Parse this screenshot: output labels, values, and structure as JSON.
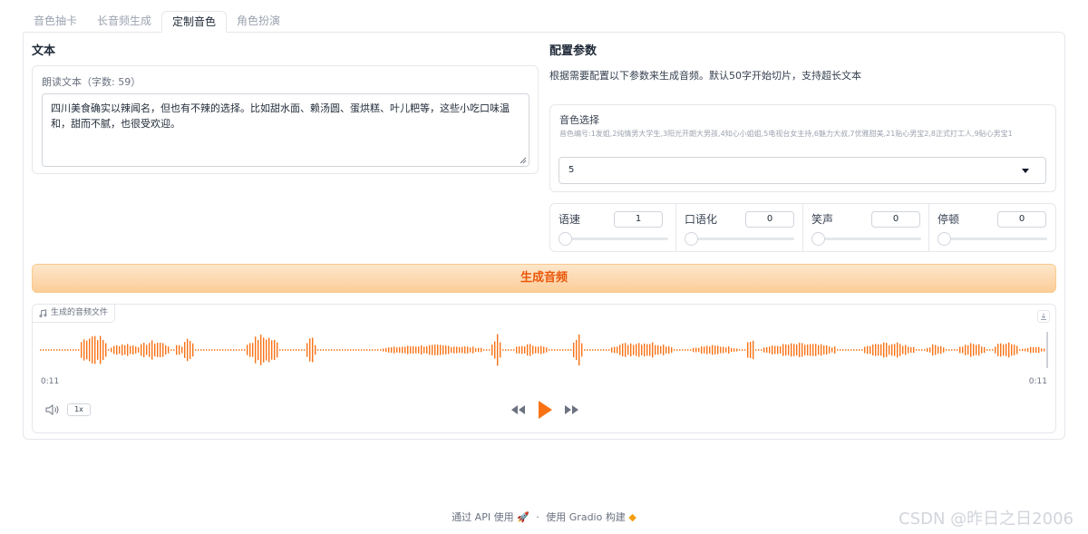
{
  "tabs": [
    {
      "label": "音色抽卡",
      "active": false
    },
    {
      "label": "长音频生成",
      "active": false
    },
    {
      "label": "定制音色",
      "active": true
    },
    {
      "label": "角色扮演",
      "active": false
    }
  ],
  "text_section": {
    "title": "文本",
    "field_label": "朗读文本（字数: 59）",
    "value": "四川美食确实以辣闻名，但也有不辣的选择。比如甜水面、赖汤圆、蛋烘糕、叶儿粑等，这些小吃口味温和，甜而不腻，也很受欢迎。"
  },
  "config_section": {
    "title": "配置参数",
    "description": "根据需要配置以下参数来生成音频。默认50字开始切片，支持超长文本",
    "voice": {
      "label": "音色选择",
      "hint": "音色编号:1发姐,2纯情男大学生,3阳光开朗大男孩,4知心小姐姐,5电视台女主持,6魅力大叔,7优雅甜美,21贴心男宝2,8正式打工人,9贴心男宝1",
      "selected": "5"
    },
    "sliders": [
      {
        "label": "语速",
        "value": "1"
      },
      {
        "label": "口语化",
        "value": "0"
      },
      {
        "label": "笑声",
        "value": "0"
      },
      {
        "label": "停顿",
        "value": "0"
      }
    ]
  },
  "generate_button": "生成音频",
  "audio": {
    "label": "生成的音频文件",
    "current_time": "0:11",
    "duration": "0:11",
    "speed": "1x",
    "accent": "#f97316"
  },
  "footer": {
    "api_text": "通过 API 使用",
    "separator": "·",
    "built_text": "使用 Gradio 构建"
  },
  "watermark": "CSDN @昨日之日2006"
}
